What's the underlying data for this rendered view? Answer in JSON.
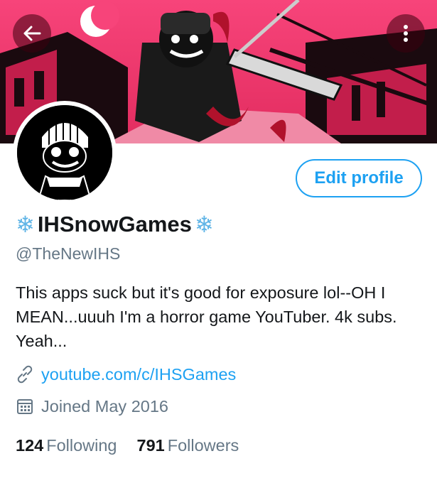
{
  "header": {
    "back_icon": "arrow-left-icon",
    "more_icon": "vertical-dots-icon"
  },
  "profile": {
    "edit_label": "Edit profile",
    "name_prefix_emoji": "❄",
    "display_name": "IHSnowGames",
    "name_suffix_emoji": "❄",
    "handle": "@TheNewIHS",
    "bio": "This apps suck but it's good for exposure lol--OH I MEAN...uuuh I'm a horror game YouTuber. 4k subs. Yeah...",
    "link": "youtube.com/c/IHSGames",
    "joined": "Joined May 2016"
  },
  "stats": {
    "following_count": "124",
    "following_label": "Following",
    "followers_count": "791",
    "followers_label": "Followers"
  },
  "colors": {
    "accent": "#1da1f2",
    "banner_pink": "#e8366a",
    "secondary_text": "#657786"
  }
}
